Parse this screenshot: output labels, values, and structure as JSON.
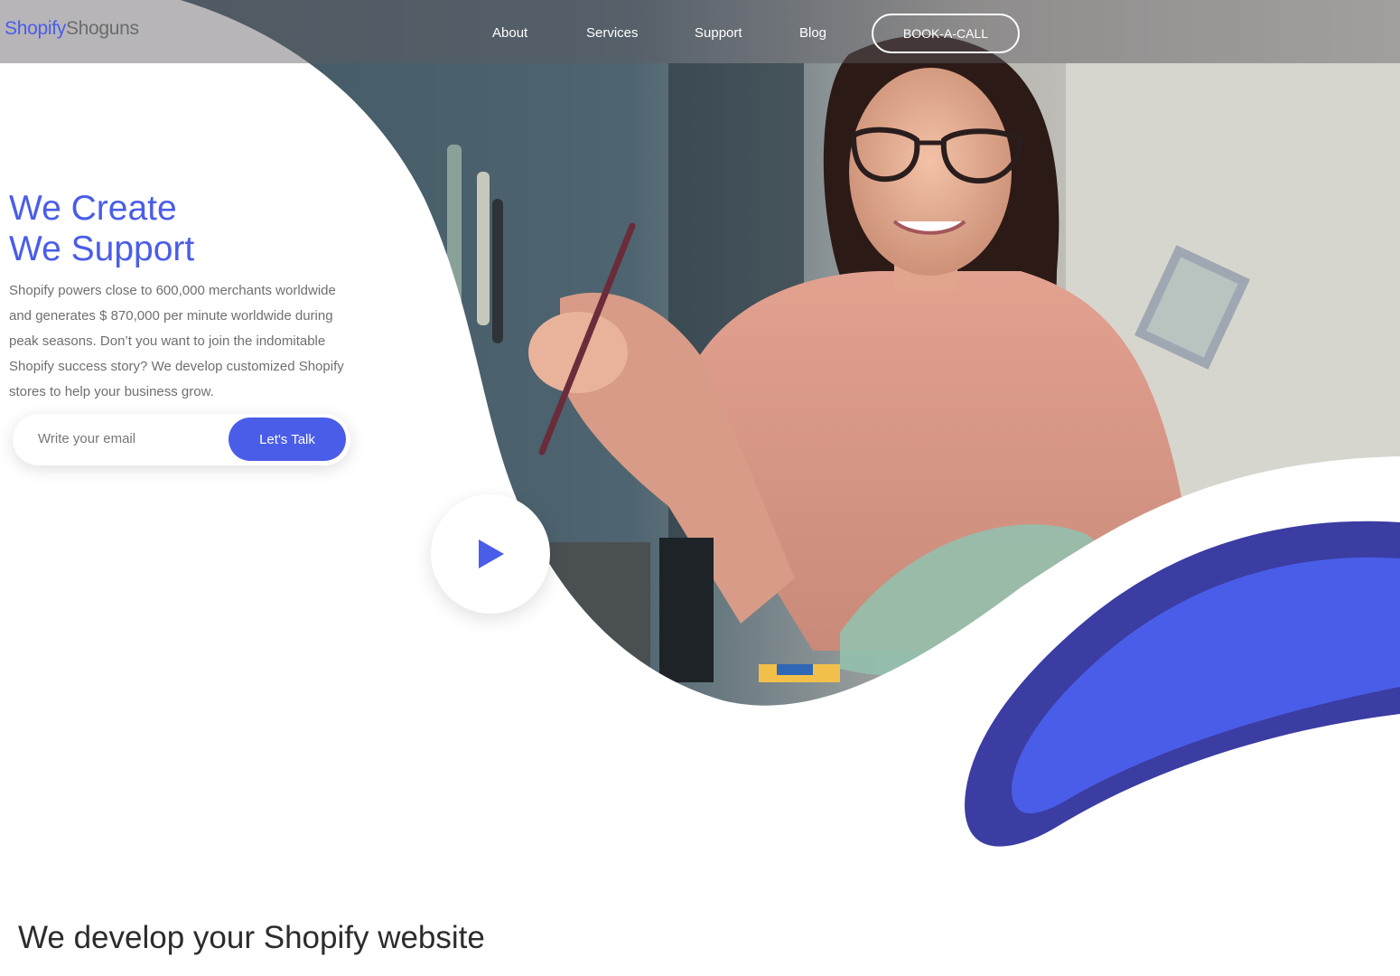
{
  "navbar": {
    "logo_part1": "Shopify",
    "logo_part2": "Shoguns",
    "links": [
      "About",
      "Services",
      "Support",
      "Blog"
    ],
    "cta_label": "BOOK-A-CALL"
  },
  "hero": {
    "headline_line1": "We Create",
    "headline_line2": "We Support",
    "paragraph": "Shopify powers close to 600,000 merchants worldwide and generates $ 870,000 per minute worldwide during peak seasons. Don’t you want to join the indomitable Shopify success story? We develop customized Shopify stores to help your business grow.",
    "email_placeholder": "Write your email",
    "submit_label": "Let's Talk"
  },
  "section": {
    "title": "We develop your Shopify website"
  },
  "colors": {
    "brand": "#4a5de8",
    "blob_dark": "#3b3da3",
    "blob_light": "#4a5de8"
  }
}
